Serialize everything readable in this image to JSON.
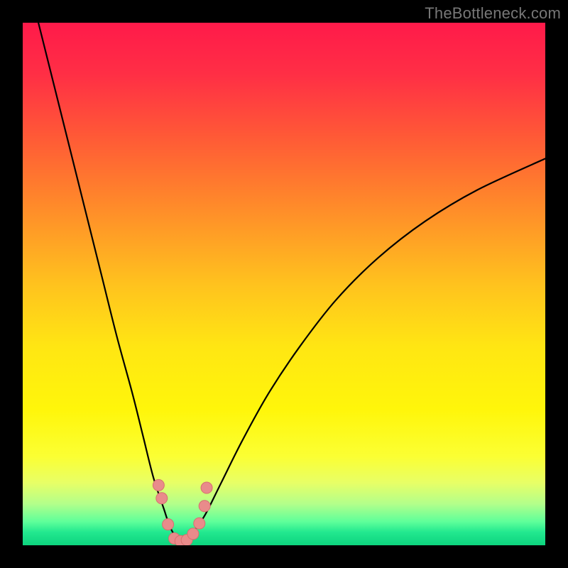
{
  "watermark": "TheBottleneck.com",
  "colors": {
    "frame": "#000000",
    "watermark": "#777777",
    "curve": "#000000",
    "marker_fill": "#e98b8b",
    "marker_stroke": "#d76f6f",
    "gradient_stops": [
      {
        "offset": 0.0,
        "color": "#ff1a4a"
      },
      {
        "offset": 0.1,
        "color": "#ff2f45"
      },
      {
        "offset": 0.22,
        "color": "#ff5a36"
      },
      {
        "offset": 0.35,
        "color": "#ff8a2a"
      },
      {
        "offset": 0.5,
        "color": "#ffc21e"
      },
      {
        "offset": 0.62,
        "color": "#ffe613"
      },
      {
        "offset": 0.74,
        "color": "#fff60a"
      },
      {
        "offset": 0.83,
        "color": "#fbff33"
      },
      {
        "offset": 0.88,
        "color": "#e8ff66"
      },
      {
        "offset": 0.92,
        "color": "#b4ff8a"
      },
      {
        "offset": 0.955,
        "color": "#5eff9a"
      },
      {
        "offset": 0.975,
        "color": "#22e88f"
      },
      {
        "offset": 1.0,
        "color": "#0dd47e"
      }
    ]
  },
  "chart_data": {
    "type": "line",
    "title": "",
    "xlabel": "",
    "ylabel": "",
    "xlim": [
      0,
      100
    ],
    "ylim": [
      0,
      100
    ],
    "series": [
      {
        "name": "bottleneck-curve",
        "x": [
          3,
          6,
          9,
          12,
          15,
          18,
          21,
          23,
          25,
          27,
          28,
          29,
          30,
          31,
          32,
          33,
          35,
          38,
          42,
          47,
          53,
          60,
          68,
          77,
          87,
          100
        ],
        "y": [
          100,
          88,
          76,
          64,
          52,
          40,
          29,
          21,
          13,
          7,
          4,
          2,
          1,
          1,
          2,
          3,
          6,
          12,
          20,
          29,
          38,
          47,
          55,
          62,
          68,
          74
        ]
      }
    ],
    "markers": {
      "name": "highlight-points",
      "x": [
        26.0,
        26.6,
        27.8,
        29.0,
        30.2,
        31.4,
        32.6,
        33.8,
        34.8,
        35.2
      ],
      "y": [
        11.5,
        9.0,
        4.0,
        1.3,
        0.8,
        1.0,
        2.2,
        4.2,
        7.5,
        11.0
      ]
    }
  }
}
